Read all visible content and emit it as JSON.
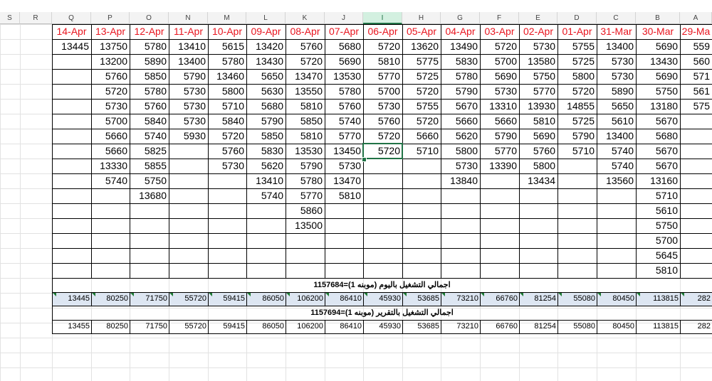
{
  "sheet": {
    "col_headers": [
      "S",
      "R",
      "Q",
      "P",
      "O",
      "N",
      "M",
      "L",
      "K",
      "J",
      "I",
      "H",
      "G",
      "F",
      "E",
      "D",
      "C",
      "B",
      "A"
    ],
    "selected_col": "I",
    "dates": [
      "14-Apr",
      "13-Apr",
      "12-Apr",
      "11-Apr",
      "10-Apr",
      "09-Apr",
      "08-Apr",
      "07-Apr",
      "06-Apr",
      "05-Apr",
      "04-Apr",
      "03-Apr",
      "02-Apr",
      "01-Apr",
      "31-Mar",
      "30-Mar",
      "29-Ma"
    ],
    "rows": [
      [
        "13445",
        "13750",
        "5780",
        "13410",
        "5615",
        "13420",
        "5760",
        "5680",
        "5720",
        "13620",
        "13490",
        "5720",
        "5730",
        "5755",
        "13400",
        "5690",
        "559"
      ],
      [
        "",
        "13200",
        "5890",
        "13400",
        "5780",
        "13430",
        "5720",
        "5690",
        "5810",
        "5775",
        "5830",
        "5700",
        "13580",
        "5725",
        "5730",
        "13430",
        "560"
      ],
      [
        "",
        "5760",
        "5850",
        "5790",
        "13460",
        "5650",
        "13470",
        "13530",
        "5770",
        "5725",
        "5780",
        "5690",
        "5750",
        "5800",
        "5730",
        "5690",
        "571"
      ],
      [
        "",
        "5720",
        "5780",
        "5730",
        "5800",
        "5630",
        "13550",
        "5780",
        "5700",
        "5720",
        "5790",
        "5730",
        "5770",
        "5720",
        "5890",
        "5750",
        "561"
      ],
      [
        "",
        "5730",
        "5760",
        "5730",
        "5710",
        "5680",
        "5810",
        "5760",
        "5730",
        "5755",
        "5670",
        "13310",
        "13930",
        "14855",
        "5650",
        "13180",
        "575"
      ],
      [
        "",
        "5700",
        "5840",
        "5730",
        "5840",
        "5790",
        "5850",
        "5740",
        "5760",
        "5720",
        "5660",
        "5660",
        "5810",
        "5725",
        "5610",
        "5670",
        ""
      ],
      [
        "",
        "5660",
        "5740",
        "5930",
        "5720",
        "5850",
        "5810",
        "5770",
        "5720",
        "5660",
        "5620",
        "5790",
        "5690",
        "5790",
        "13400",
        "5680",
        ""
      ],
      [
        "",
        "5660",
        "5825",
        "",
        "5760",
        "5830",
        "13530",
        "13450",
        "5720",
        "5710",
        "5800",
        "5770",
        "5760",
        "5710",
        "5740",
        "5670",
        ""
      ],
      [
        "",
        "13330",
        "5855",
        "",
        "5730",
        "5620",
        "5790",
        "5730",
        "",
        "",
        "5730",
        "13390",
        "5800",
        "",
        "5740",
        "5670",
        ""
      ],
      [
        "",
        "5740",
        "5750",
        "",
        "",
        "13410",
        "5780",
        "13470",
        "",
        "",
        "13840",
        "",
        "13434",
        "",
        "13560",
        "13160",
        ""
      ],
      [
        "",
        "",
        "13680",
        "",
        "",
        "5740",
        "5770",
        "5810",
        "",
        "",
        "",
        "",
        "",
        "",
        "",
        "5710",
        ""
      ],
      [
        "",
        "",
        "",
        "",
        "",
        "",
        "5860",
        "",
        "",
        "",
        "",
        "",
        "",
        "",
        "",
        "5610",
        ""
      ],
      [
        "",
        "",
        "",
        "",
        "",
        "",
        "13500",
        "",
        "",
        "",
        "",
        "",
        "",
        "",
        "",
        "5750",
        ""
      ],
      [
        "",
        "",
        "",
        "",
        "",
        "",
        "",
        "",
        "",
        "",
        "",
        "",
        "",
        "",
        "",
        "5700",
        ""
      ],
      [
        "",
        "",
        "",
        "",
        "",
        "",
        "",
        "",
        "",
        "",
        "",
        "",
        "",
        "",
        "",
        "5645",
        ""
      ],
      [
        "",
        "",
        "",
        "",
        "",
        "",
        "",
        "",
        "",
        "",
        "",
        "",
        "",
        "",
        "",
        "5810",
        ""
      ]
    ],
    "total_daily_label": "اجمالي التشغيل باليوم (موبنه 1)=1157684",
    "total_daily": [
      "13445",
      "80250",
      "71750",
      "55720",
      "59415",
      "86050",
      "106200",
      "86410",
      "45930",
      "53685",
      "73210",
      "66760",
      "81254",
      "55080",
      "80450",
      "113815",
      "282"
    ],
    "total_report_label": "اجمالي التشغيل بالتقرير (موبنه 1)=1157694",
    "total_report": [
      "13455",
      "80250",
      "71750",
      "55720",
      "59415",
      "86050",
      "106200",
      "86410",
      "45930",
      "53685",
      "73210",
      "66760",
      "81254",
      "55080",
      "80450",
      "113815",
      "282"
    ],
    "selected_cell_value": "5720"
  },
  "colors": {
    "date_red": "#e8141e",
    "total_band": "#dde6f2",
    "selection_green": "#217346"
  }
}
